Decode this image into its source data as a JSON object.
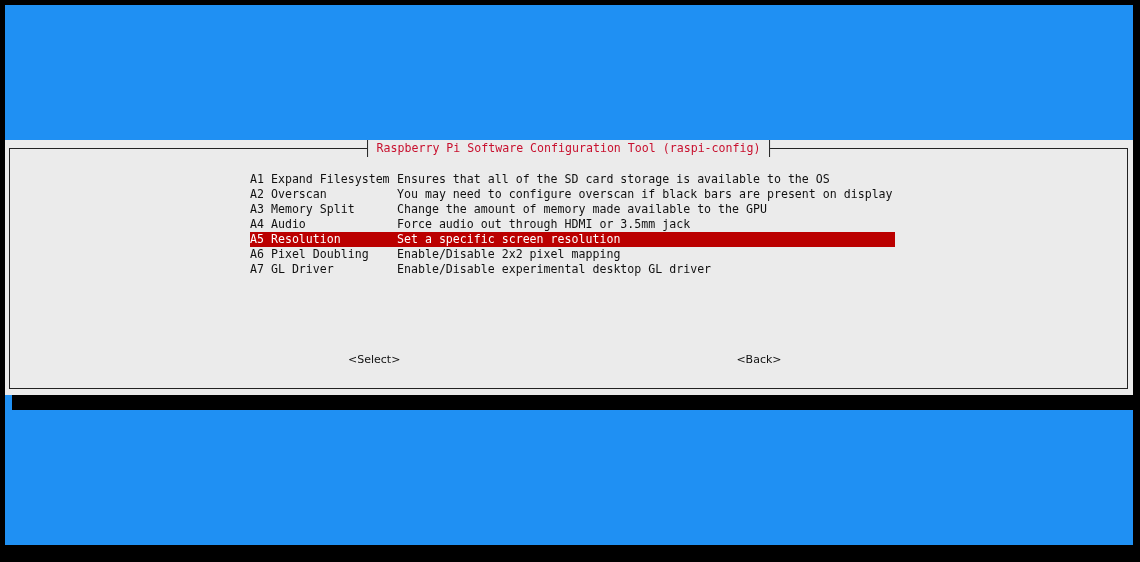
{
  "dialog": {
    "title": "Raspberry Pi Software Configuration Tool (raspi-config)"
  },
  "menu": [
    {
      "label": "A1 Expand Filesystem",
      "description": "Ensures that all of the SD card storage is available to the OS",
      "selected": false
    },
    {
      "label": "A2 Overscan",
      "description": "You may need to configure overscan if black bars are present on display",
      "selected": false
    },
    {
      "label": "A3 Memory Split",
      "description": "Change the amount of memory made available to the GPU",
      "selected": false
    },
    {
      "label": "A4 Audio",
      "description": "Force audio out through HDMI or 3.5mm jack",
      "selected": false
    },
    {
      "label": "A5 Resolution",
      "description": "Set a specific screen resolution",
      "selected": true
    },
    {
      "label": "A6 Pixel Doubling",
      "description": "Enable/Disable 2x2 pixel mapping",
      "selected": false
    },
    {
      "label": "A7 GL Driver",
      "description": "Enable/Disable experimental desktop GL driver",
      "selected": false
    }
  ],
  "buttons": [
    "<Select>",
    "<Back>"
  ]
}
